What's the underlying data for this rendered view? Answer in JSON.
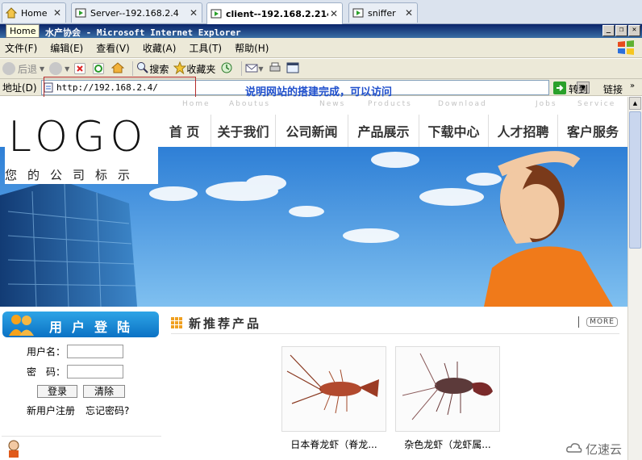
{
  "vm_tabs": [
    {
      "label": "Home"
    },
    {
      "label": "Server--192.168.2.4"
    },
    {
      "label": "client--192.168.2.214"
    },
    {
      "label": "sniffer"
    }
  ],
  "tooltip": "Home",
  "ie_title": "水产协会 - Microsoft Internet Explorer",
  "menu": [
    "文件(F)",
    "编辑(E)",
    "查看(V)",
    "收藏(A)",
    "工具(T)",
    "帮助(H)"
  ],
  "toolbar": {
    "back": "后退",
    "search": "搜索",
    "favorites": "收藏夹"
  },
  "address": {
    "label": "地址(D)",
    "url": "http://192.168.2.4/",
    "annotation": "说明网站的搭建完成，可以访问",
    "go": "转到",
    "links": "链接"
  },
  "site": {
    "logo": "LOGO",
    "logo_sub": "您的公司标示",
    "nav_en": [
      "Home",
      "Aboutus",
      "News",
      "Products",
      "Download",
      "Jobs",
      "Service"
    ],
    "nav": [
      "首 页",
      "关于我们",
      "公司新闻",
      "产品展示",
      "下载中心",
      "人才招聘",
      "客户服务"
    ]
  },
  "login": {
    "title": "用户登陆",
    "username_label": "用户名：",
    "password_label": "密　码：",
    "login_btn": "登录",
    "clear_btn": "清除",
    "register": "新用户注册",
    "forgot": "忘记密码?"
  },
  "products": {
    "title": "新推荐产品",
    "more": "MORE",
    "items": [
      {
        "name": "日本脊龙虾（脊龙..."
      },
      {
        "name": "杂色龙虾（龙虾属..."
      }
    ]
  },
  "watermark": "亿速云"
}
